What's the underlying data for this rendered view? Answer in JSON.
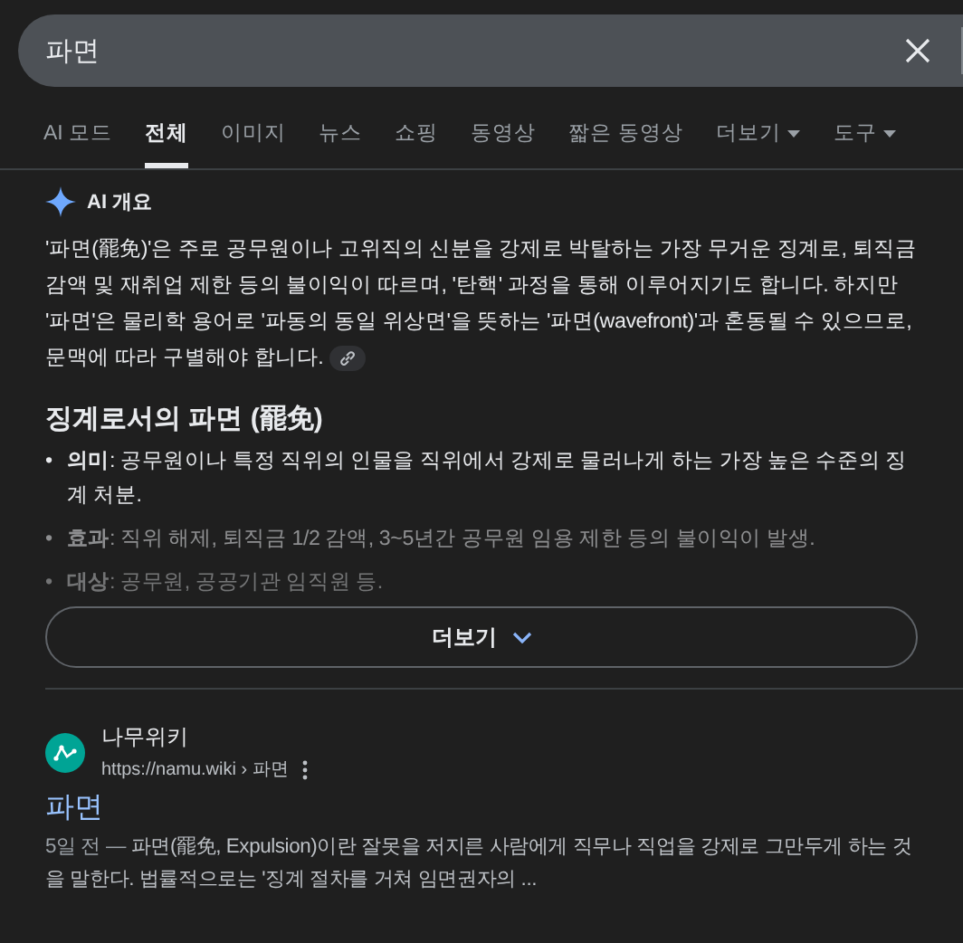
{
  "search": {
    "value": "파면"
  },
  "tabs": [
    {
      "label": "AI 모드",
      "selected": false,
      "kind": "tab"
    },
    {
      "label": "전체",
      "selected": true,
      "kind": "tab"
    },
    {
      "label": "이미지",
      "selected": false,
      "kind": "tab"
    },
    {
      "label": "뉴스",
      "selected": false,
      "kind": "tab"
    },
    {
      "label": "쇼핑",
      "selected": false,
      "kind": "tab"
    },
    {
      "label": "동영상",
      "selected": false,
      "kind": "tab"
    },
    {
      "label": "짧은 동영상",
      "selected": false,
      "kind": "tab"
    },
    {
      "label": "더보기",
      "selected": false,
      "kind": "dropdown"
    },
    {
      "label": "도구",
      "selected": false,
      "kind": "dropdown"
    }
  ],
  "ai_overview": {
    "title": "AI 개요",
    "summary": "'파면(罷免)'은 주로 공무원이나 고위직의 신분을 강제로 박탈하는 가장 무거운 징계로, 퇴직금 감액 및 재취업 제한 등의 불이익이 따르며, '탄핵' 과정을 통해 이루어지기도 합니다. 하지만 '파면'은 물리학 용어로 '파동의 동일 위상면'을 뜻하는 '파면(wavefront)'과 혼동될 수 있으므로, 문맥에 따라 구별해야 합니다.",
    "heading": "징계로서의 파면 (罷免)",
    "bullets": [
      {
        "marker": "•",
        "text": "**의미**: 공무원이나 특정 직위의 인물을 직위에서 강제로 물러나게 하는 가장 높은 수준의 징계 처분."
      },
      {
        "marker": "•",
        "text": "**효과**: 직위 해제, 퇴직금 1/2 감액, 3~5년간 공무원 임용 제한 등의 불이익이 발생."
      },
      {
        "marker": "•",
        "text": "**대상**: 공무원, 공공기관 임직원 등."
      }
    ],
    "more_button": "더보기"
  },
  "result": {
    "site": "나무위키",
    "url": "https://namu.wiki › 파면",
    "title": "파면",
    "date": "5일 전",
    "separator": "—",
    "snippet": "파면(罷免, Expulsion)이란 잘못을 저지른 사람에게 직무나 직업을 강제로 그만두게 하는 것을 말한다. 법률적으로는 '징계 절차를 거쳐 임면권자의 ..."
  }
}
